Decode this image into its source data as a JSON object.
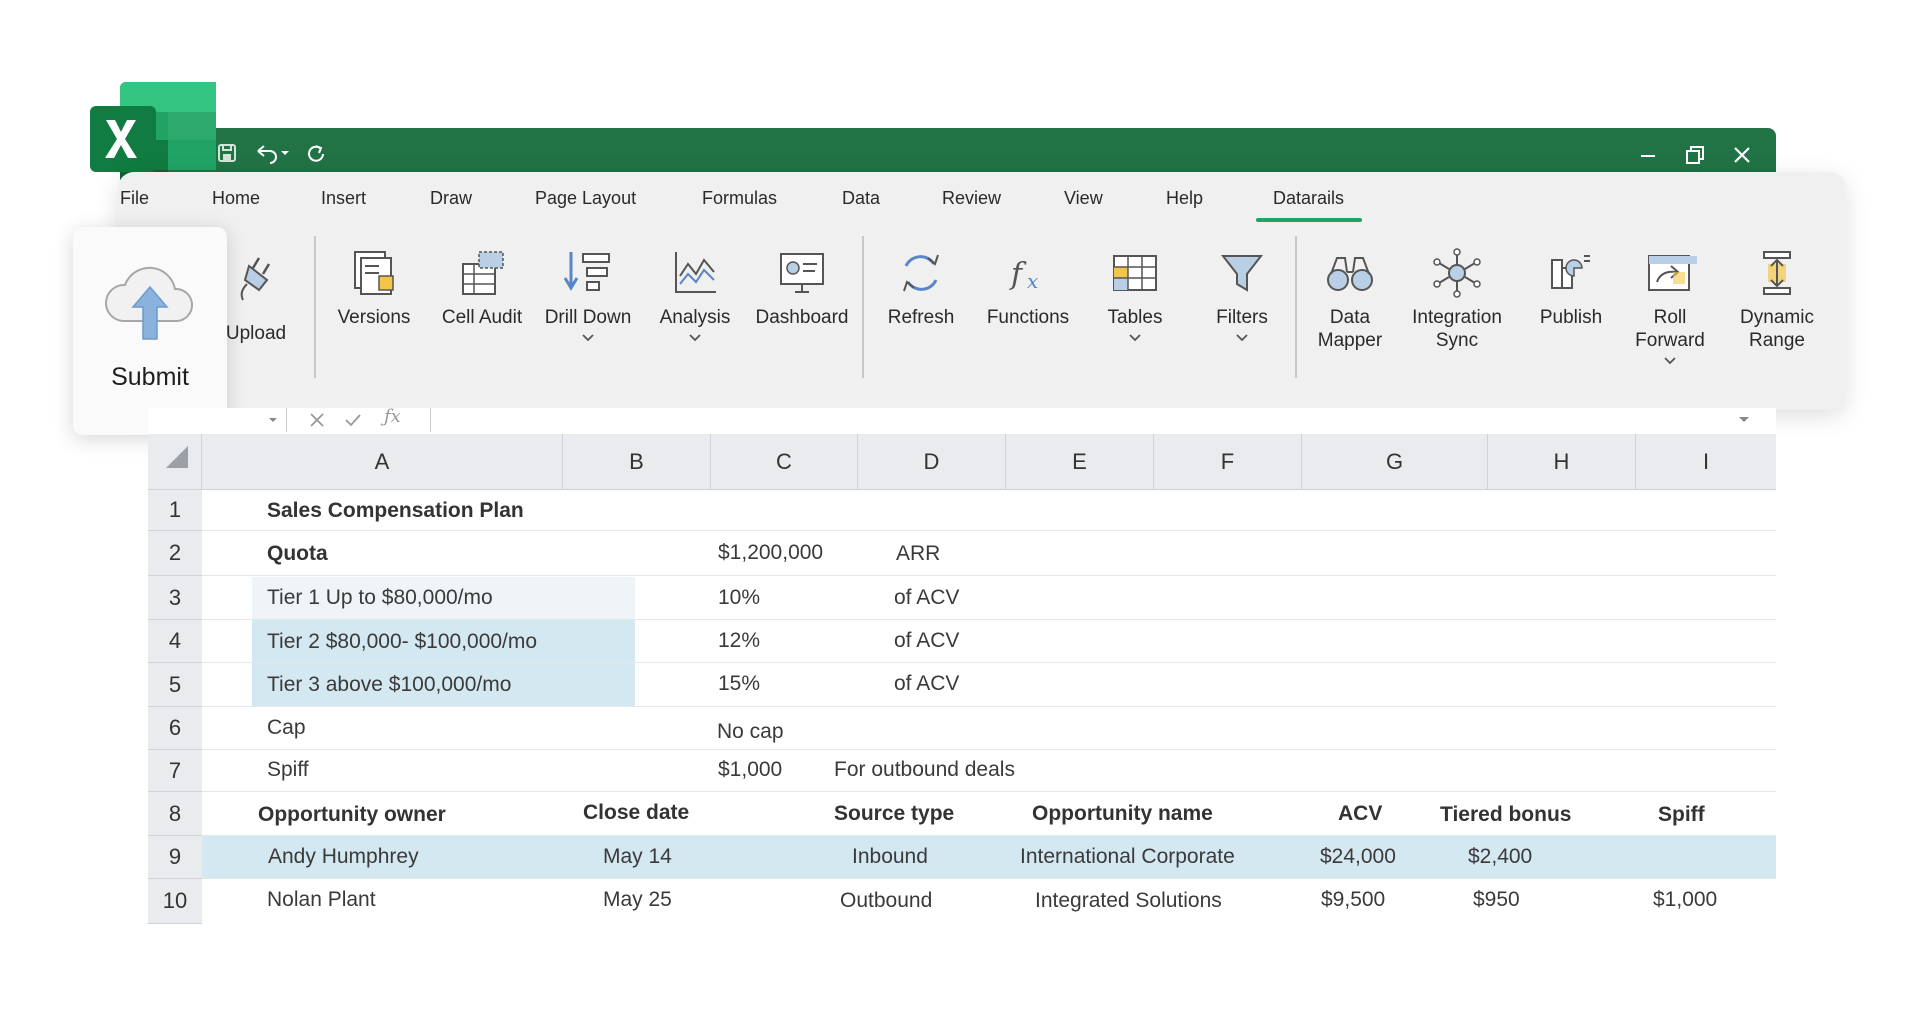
{
  "ribbon": {
    "tabs": [
      "File",
      "Home",
      "Insert",
      "Draw",
      "Page Layout",
      "Formulas",
      "Data",
      "Review",
      "View",
      "Help",
      "Datarails"
    ],
    "active_tab": "Datarails",
    "buttons": {
      "upload": "Upload",
      "versions": "Versions",
      "cell_audit": "Cell Audit",
      "drill_down": "Drill Down",
      "analysis": "Analysis",
      "dashboard": "Dashboard",
      "refresh": "Refresh",
      "functions": "Functions",
      "tables": "Tables",
      "filters": "Filters",
      "data_mapper_1": "Data",
      "data_mapper_2": "Mapper",
      "integration_sync_1": "Integration",
      "integration_sync_2": "Sync",
      "publish": "Publish",
      "roll_forward_1": "Roll",
      "roll_forward_2": "Forward",
      "dynamic_range_1": "Dynamic",
      "dynamic_range_2": "Range"
    },
    "accent_color": "#21a366"
  },
  "submit_card": {
    "label": "Submit"
  },
  "sheet": {
    "columns": [
      "A",
      "B",
      "C",
      "D",
      "E",
      "F",
      "G",
      "H",
      "I"
    ],
    "rows": [
      "1",
      "2",
      "3",
      "4",
      "5",
      "6",
      "7",
      "8",
      "9",
      "10"
    ],
    "r1": {
      "a": "Sales Compensation Plan"
    },
    "r2": {
      "a": "Quota",
      "c": "$1,200,000",
      "d": "ARR"
    },
    "r3": {
      "a": "Tier 1 Up to $80,000/mo",
      "c": "10%",
      "d": "of ACV"
    },
    "r4": {
      "a": "Tier 2  $80,000- $100,000/mo",
      "c": "12%",
      "d": "of ACV"
    },
    "r5": {
      "a": "Tier 3 above $100,000/mo",
      "c": "15%",
      "d": "of ACV"
    },
    "r6": {
      "a": "Cap",
      "c": "No cap"
    },
    "r7": {
      "a": "Spiff",
      "c": "$1,000",
      "d": "For outbound deals"
    },
    "header": [
      "Opportunity owner",
      "Close date",
      "Source type",
      "Opportunity  name",
      "ACV",
      "Tiered bonus",
      "Spiff"
    ],
    "records": [
      [
        "Andy Humphrey",
        "May 14",
        "Inbound",
        "International Corporate",
        "$24,000",
        "$2,400",
        ""
      ],
      [
        "Nolan Plant",
        "May 25",
        "Outbound",
        "Integrated Solutions",
        "$9,500",
        "$950",
        "$1,000"
      ]
    ]
  },
  "colors": {
    "titlebar": "#217346",
    "row_highlight": "#d4e8f2"
  }
}
